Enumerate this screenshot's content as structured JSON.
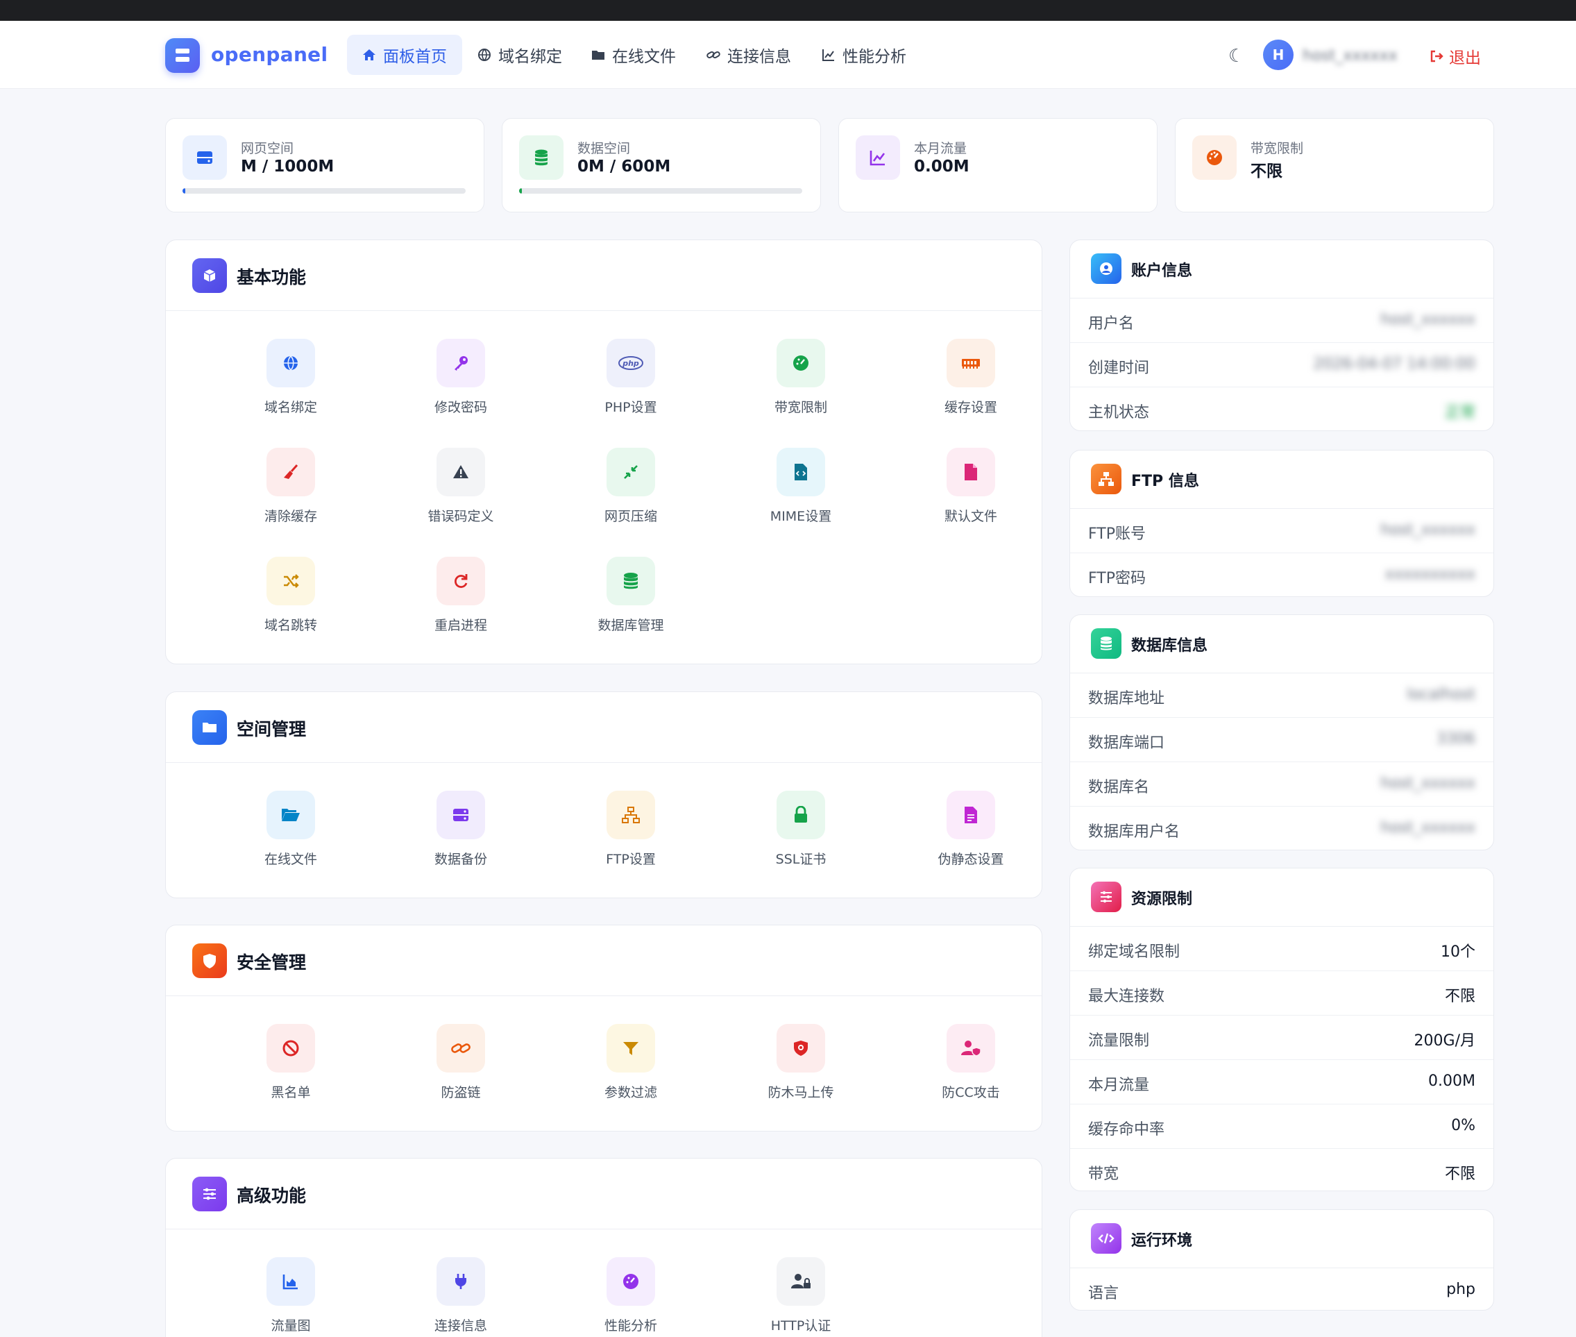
{
  "brand": "openpanel",
  "nav": {
    "items": [
      {
        "label": "面板首页",
        "icon": "home-icon"
      },
      {
        "label": "域名绑定",
        "icon": "globe-icon"
      },
      {
        "label": "在线文件",
        "icon": "folder-icon"
      },
      {
        "label": "连接信息",
        "icon": "link-icon"
      },
      {
        "label": "性能分析",
        "icon": "chart-line-icon"
      }
    ],
    "avatar_letter": "H",
    "username": "host_xxxxxx",
    "logout": "退出"
  },
  "stats": [
    {
      "label": "网页空间",
      "value": "M / 1000M",
      "progress": 0.01,
      "color": "#2563eb"
    },
    {
      "label": "数据空间",
      "value": "0M / 600M",
      "progress": 0.01,
      "color": "#16a34a"
    },
    {
      "label": "本月流量",
      "value": "0.00M",
      "color": "#9333ea"
    },
    {
      "label": "带宽限制",
      "value": "不限",
      "color": "#ea580c"
    }
  ],
  "sections": {
    "basic": {
      "title": "基本功能",
      "items": [
        "域名绑定",
        "修改密码",
        "PHP设置",
        "带宽限制",
        "缓存设置",
        "清除缓存",
        "错误码定义",
        "网页压缩",
        "MIME设置",
        "默认文件",
        "域名跳转",
        "重启进程",
        "数据库管理"
      ]
    },
    "space": {
      "title": "空间管理",
      "items": [
        "在线文件",
        "数据备份",
        "FTP设置",
        "SSL证书",
        "伪静态设置"
      ]
    },
    "security": {
      "title": "安全管理",
      "items": [
        "黑名单",
        "防盗链",
        "参数过滤",
        "防木马上传",
        "防CC攻击"
      ]
    },
    "advanced": {
      "title": "高级功能",
      "items": [
        "流量图",
        "连接信息",
        "性能分析",
        "HTTP认证"
      ]
    }
  },
  "account": {
    "title": "账户信息",
    "rows": [
      {
        "k": "用户名",
        "v": "host_xxxxxx"
      },
      {
        "k": "创建时间",
        "v": "2026-04-07 14:00:00"
      },
      {
        "k": "主机状态",
        "v": "正常"
      }
    ]
  },
  "ftp": {
    "title": "FTP 信息",
    "rows": [
      {
        "k": "FTP账号",
        "v": "host_xxxxxx"
      },
      {
        "k": "FTP密码",
        "v": "xxxxxxxxxx"
      }
    ]
  },
  "database": {
    "title": "数据库信息",
    "rows": [
      {
        "k": "数据库地址",
        "v": "localhost"
      },
      {
        "k": "数据库端口",
        "v": "3306"
      },
      {
        "k": "数据库名",
        "v": "host_xxxxxx"
      },
      {
        "k": "数据库用户名",
        "v": "host_xxxxxx"
      }
    ]
  },
  "resources": {
    "title": "资源限制",
    "rows": [
      {
        "k": "绑定域名限制",
        "v": "10个"
      },
      {
        "k": "最大连接数",
        "v": "不限"
      },
      {
        "k": "流量限制",
        "v": "200G/月"
      },
      {
        "k": "本月流量",
        "v": "0.00M"
      },
      {
        "k": "缓存命中率",
        "v": "0%"
      },
      {
        "k": "带宽",
        "v": "不限"
      }
    ]
  },
  "runtime": {
    "title": "运行环境",
    "rows": [
      {
        "k": "语言",
        "v": "php"
      }
    ]
  }
}
